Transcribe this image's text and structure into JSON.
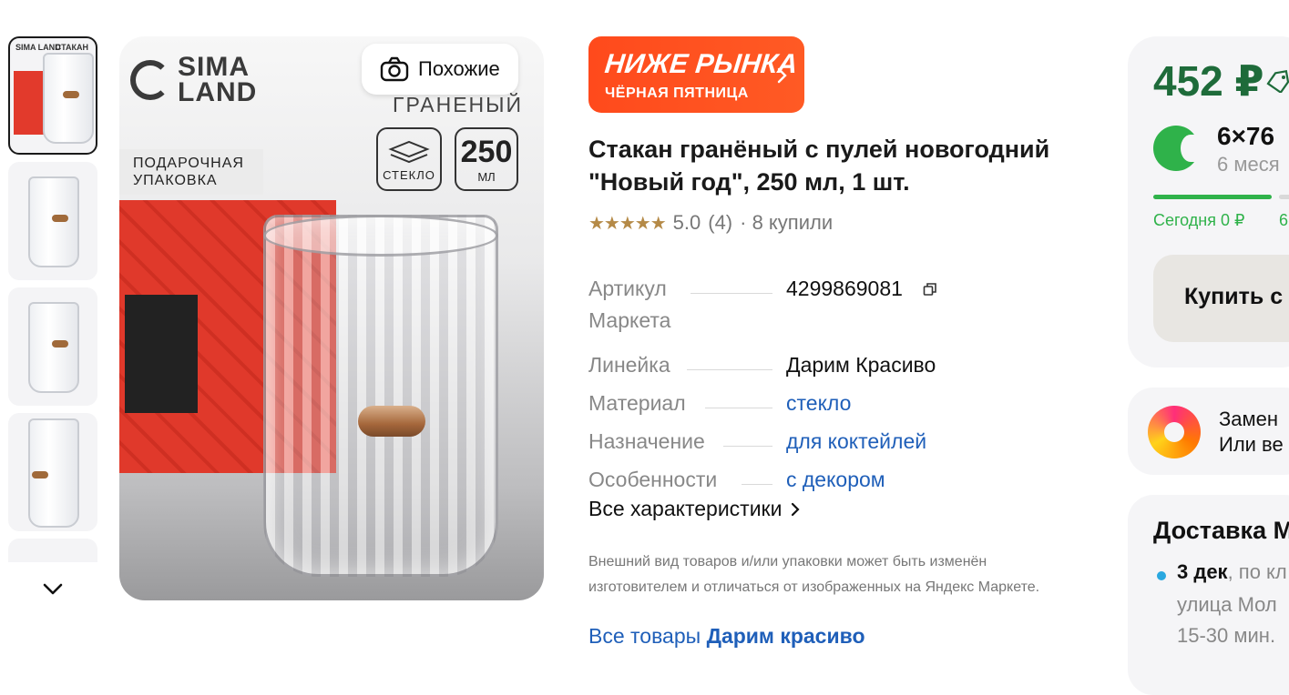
{
  "gallery": {
    "thumbnails": [
      {
        "kind": "boxed",
        "brand": "SIMA LAND",
        "word": "СТАКАН"
      },
      {
        "kind": "glass"
      },
      {
        "kind": "glass"
      },
      {
        "kind": "glass-close"
      },
      {
        "kind": "partial"
      }
    ],
    "main_image": {
      "brand_text": "SIMA LAND",
      "gift_label": "ПОДАРОЧНАЯ УПАКОВКА",
      "faceted_label": "ГРАНЕНЫЙ",
      "badge_glass": "СТЕКЛО",
      "badge_volume_number": "250",
      "badge_volume_unit": "МЛ"
    },
    "similar_button": "Похожие"
  },
  "promo": {
    "title": "НИЖЕ РЫНКА",
    "subtitle": "ЧЁРНАЯ ПЯТНИЦА"
  },
  "product": {
    "title": "Стакан гранёный с пулей новогодний \"Новый год\", 250 мл, 1 шт.",
    "rating_value": "5.0",
    "rating_count": "(4)",
    "bought": "· 8 купили",
    "stars": "★★★★★"
  },
  "specs": [
    {
      "key": "Артикул Маркета",
      "value": "4299869081",
      "link": false
    },
    {
      "key": "Линейка",
      "value": "Дарим Красиво",
      "link": false
    },
    {
      "key": "Материал",
      "value": "стекло",
      "link": true
    },
    {
      "key": "Назначение",
      "value": "для коктейлей",
      "link": true
    },
    {
      "key": "Особенности",
      "value": "с декором",
      "link": true
    }
  ],
  "spec_keys_display": {
    "article_line1": "Артикул",
    "article_line2": "Маркета"
  },
  "all_specs_label": "Все характеристики",
  "disclaimer": "Внешний вид товаров и/или упаковки может быть изменён изготовителем и отличаться от изображенных на Яндекс Маркете.",
  "all_goods": {
    "prefix": "Все товары",
    "brand": "Дарим красиво"
  },
  "buy_card": {
    "price": "452 ₽",
    "split_main": "6×76",
    "split_sub": "6 меся",
    "today": "Сегодня 0 ₽",
    "today_next": "6",
    "buy_label": "Купить с"
  },
  "replace_card": {
    "line1": "Замен",
    "line2": "Или ве"
  },
  "delivery_card": {
    "title": "Доставка М",
    "date": "3 дек",
    "date_suffix": ", по кл",
    "address": "улица Мол",
    "time": "15-30 мин."
  },
  "colors": {
    "price_green": "#1e6b3a",
    "split_green": "#2fb24a",
    "promo_orange": "#ff4a1c",
    "link_blue": "#1f5fb9",
    "star_gold": "#b58a47"
  }
}
